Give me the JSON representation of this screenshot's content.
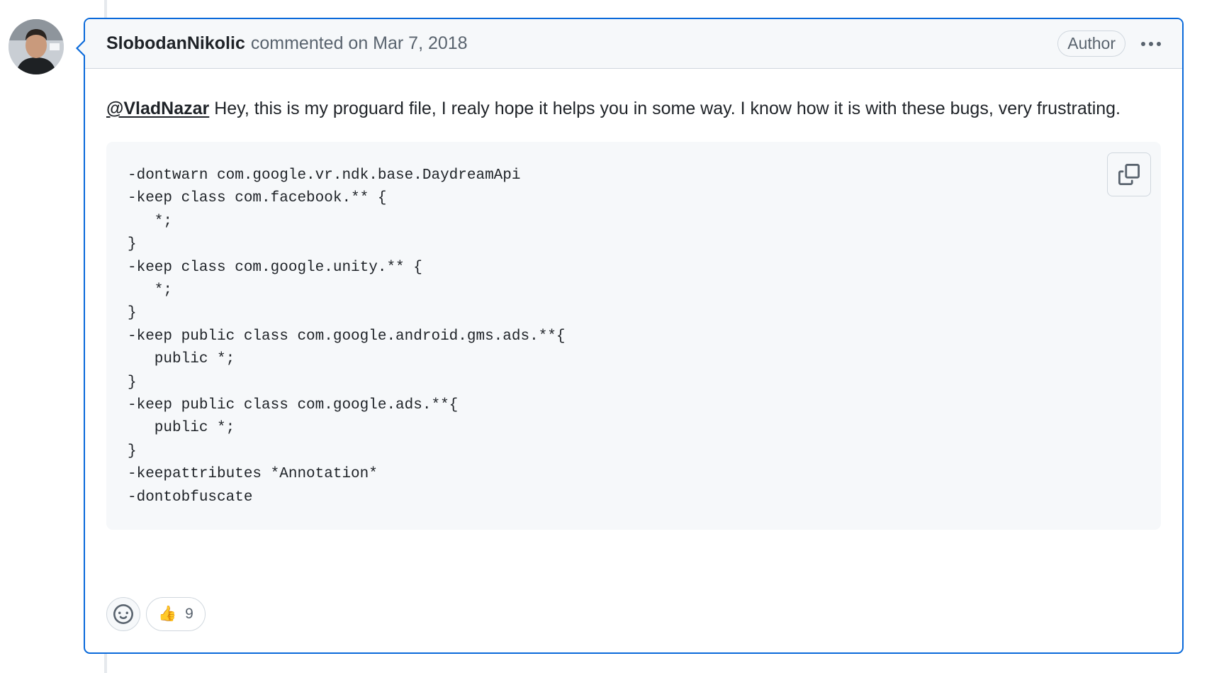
{
  "comment": {
    "author": "SlobodanNikolic",
    "meta": "commented on Mar 7, 2018",
    "badge": "Author",
    "mention": "@VladNazar",
    "body_text": " Hey, this is my proguard file, I realy hope it helps you in some way. I know how it is with these bugs, very frustrating.",
    "code_lines": [
      "-dontwarn com.google.vr.ndk.base.DaydreamApi",
      "-keep class com.facebook.** {",
      "   *;",
      "}",
      "-keep class com.google.unity.** {",
      "   *;",
      "}",
      "-keep public class com.google.android.gms.ads.**{",
      "   public *;",
      "}",
      "-keep public class com.google.ads.**{",
      "   public *;",
      "}",
      "-keepattributes *Annotation*",
      "-dontobfuscate"
    ],
    "reactions": [
      {
        "icon": "thumbs-up-icon",
        "emoji": "👍",
        "count": "9"
      }
    ]
  },
  "colors": {
    "accent": "#0969da",
    "border": "#d0d7de",
    "header_bg": "#f6f8fa",
    "muted_text": "#59636e"
  }
}
